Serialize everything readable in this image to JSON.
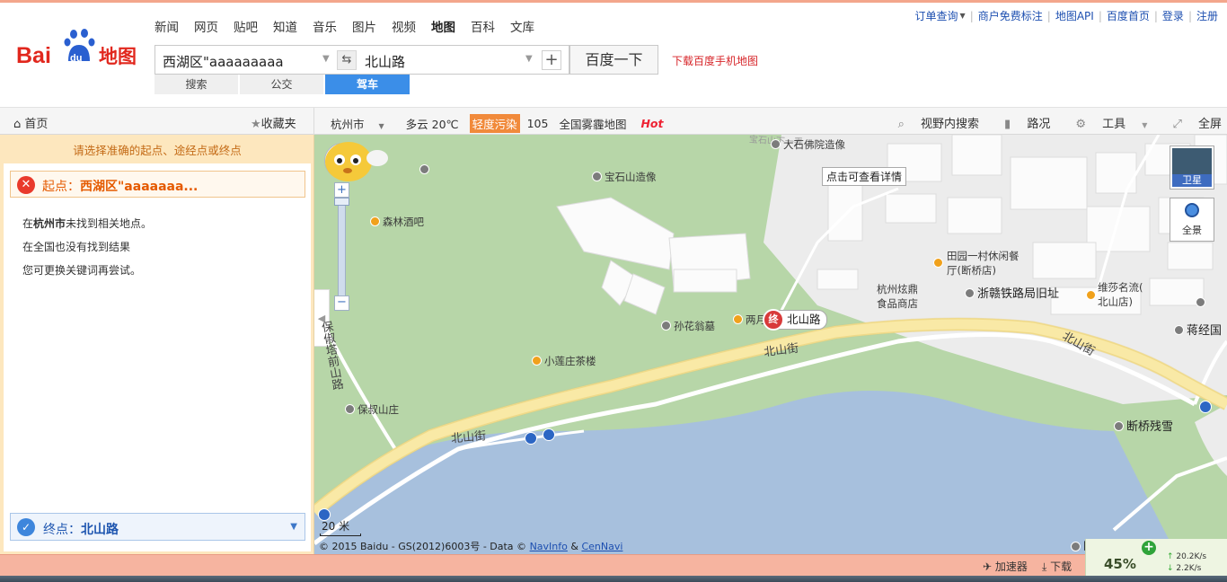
{
  "nav": [
    "新闻",
    "网页",
    "贴吧",
    "知道",
    "音乐",
    "图片",
    "视频",
    "地图",
    "百科",
    "文库"
  ],
  "nav_active": "地图",
  "top_links": [
    "订单查询",
    "商户免费标注",
    "地图API",
    "百度首页",
    "登录",
    "注册"
  ],
  "search": {
    "from": "西湖区\"aaaaaaaaa",
    "to": "北山路",
    "button": "百度一下",
    "download": "下载百度手机地图"
  },
  "mode_tabs": [
    "搜索",
    "公交",
    "驾车"
  ],
  "mode_active": "驾车",
  "toolbar": {
    "home": "首页",
    "favorites": "收藏夹",
    "city": "杭州市",
    "weather": "多云 20℃",
    "pollution": "轻度污染",
    "aqi": "105",
    "haze": "全国雾霾地图",
    "hot": "Hot",
    "visible_search": "视野内搜索",
    "traffic": "路况",
    "tools": "工具",
    "fullscreen": "全屏"
  },
  "panel": {
    "hint": "请选择准确的起点、途经点或终点",
    "start_label": "起点：",
    "start_value": "西湖区\"aaaaaaa...",
    "msg_prefix": "在",
    "msg_city": "杭州市",
    "msg_suffix": "未找到相关地点。",
    "msg2": "在全国也没有找到结果",
    "msg3": "您可更换关键词再尝试。",
    "end_label": "终点：",
    "end_value": "北山路"
  },
  "map": {
    "tooltip": "点击可查看详情",
    "end_marker_icon": "终",
    "end_marker_text": "北山路",
    "satellite": "卫星",
    "panorama": "全景",
    "scale": "20 米",
    "copyright_prefix": "© 2015 Baidu - GS(2012)6003号 - Data ©",
    "link_navinfo": "NavInfo",
    "amp": "&",
    "link_cennavi": "CenNavi",
    "labels": {
      "dashifo": "大石佛院造像",
      "baoshishan": "宝石山造像",
      "senlin": "森林酒吧",
      "tianyuan1": "田园一村休闲餐",
      "tianyuan2": "厅(断桥店)",
      "xuanding1": "杭州炫鼎",
      "xuanding2": "食品商店",
      "zhegan": "浙赣铁路局旧址",
      "weisha1": "维莎名流(",
      "weisha2": "北山店)",
      "sunhua": "孙花翁墓",
      "liangfu": "两月",
      "jiangjing": "蒋经国",
      "xiaolian": "小莲庄茶楼",
      "baochu": "保叔山庄",
      "duanqiao_snow": "断桥残雪",
      "duanqiao": "断桥",
      "beishanjie1": "北山街",
      "beishanjie2": "北山街",
      "beishanjie3": "北山街",
      "baochu_road": "保俶塔前山路",
      "baoshishan_road": "宝石山下一弄"
    }
  },
  "status": {
    "accelerator": "加速器",
    "download": "下载",
    "percent": "45%",
    "up": "20.2K/s",
    "down": "2.2K/s"
  }
}
